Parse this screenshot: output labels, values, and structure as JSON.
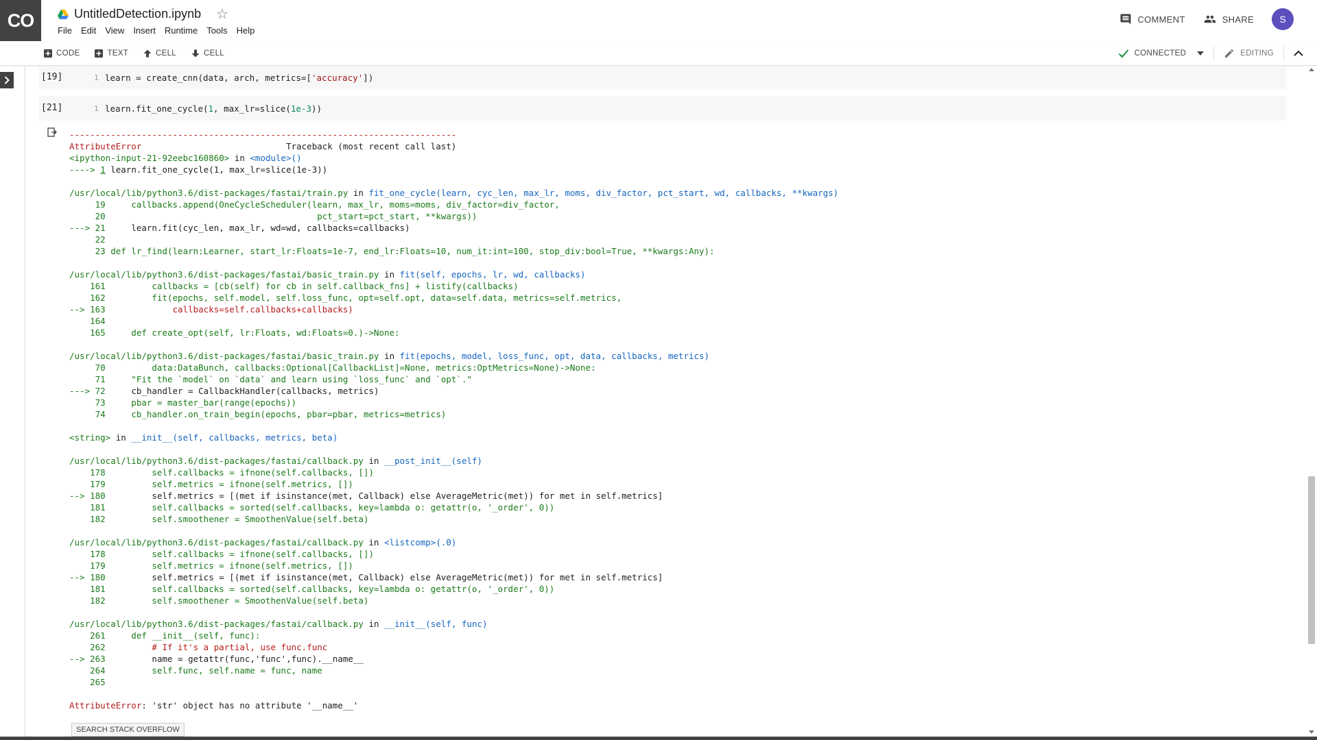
{
  "app": {
    "logo": "CO",
    "title": "UntitledDetection.ipynb",
    "menu": [
      "File",
      "Edit",
      "View",
      "Insert",
      "Runtime",
      "Tools",
      "Help"
    ],
    "comment_label": "COMMENT",
    "share_label": "SHARE",
    "avatar_letter": "S",
    "avatar_color": "#5b4fbd"
  },
  "toolbar": {
    "code_label": "CODE",
    "text_label": "TEXT",
    "cell_up_label": "CELL",
    "cell_down_label": "CELL",
    "connected_label": "CONNECTED",
    "editing_label": "EDITING"
  },
  "cells": [
    {
      "prompt": "[19]",
      "line_no": "1",
      "code_prefix": "learn = create_cnn(data, arch, metrics=[",
      "code_str": "'accuracy'",
      "code_suffix": "])"
    },
    {
      "prompt": "[21]",
      "line_no": "1",
      "code_prefix": "learn.fit_one_cycle(",
      "code_num1": "1",
      "code_mid": ", max_lr=slice(",
      "code_num2": "1e-3",
      "code_suffix": "))"
    }
  ],
  "output": {
    "dashes": "---------------------------------------------------------------------------",
    "err_type": "AttributeError",
    "traceback_label": "                            Traceback (most recent call last)",
    "ipy_input": "<ipython-input-21-92eebc160860>",
    "in_word": " in ",
    "module": "<module>()",
    "arrow1_prefix": "----> ",
    "arrow1_no": "1",
    "arrow1_code": " learn.fit_one_cycle(1, max_lr=slice(1e-3))",
    "f1_path": "/usr/local/lib/python3.6/dist-packages/fastai/train.py",
    "f1_func": "fit_one_cycle(learn, cyc_len, max_lr, moms, div_factor, pct_start, wd, callbacks, **kwargs)",
    "f1_l1": "     19     callbacks.append(OneCycleScheduler(learn, max_lr, moms=moms, div_factor=div_factor,",
    "f1_l2": "     20                                         pct_start=pct_start, **kwargs))",
    "f1_l3a": "---> 21",
    "f1_l3b": "     learn.fit(cyc_len, max_lr, wd=wd, callbacks=callbacks)",
    "f1_l4": "     22 ",
    "f1_l5": "     23 def lr_find(learn:Learner, start_lr:Floats=1e-7, end_lr:Floats=10, num_it:int=100, stop_div:bool=True, **kwargs:Any):",
    "f2_path": "/usr/local/lib/python3.6/dist-packages/fastai/basic_train.py",
    "f2_func": "fit(self, epochs, lr, wd, callbacks)",
    "f2_l1": "    161         callbacks = [cb(self) for cb in self.callback_fns] + listify(callbacks)",
    "f2_l2": "    162         fit(epochs, self.model, self.loss_func, opt=self.opt, data=self.data, metrics=self.metrics,",
    "f2_l3a": "--> 163",
    "f2_l3b": "             callbacks=self.callbacks+callbacks)",
    "f2_l4": "    164 ",
    "f2_l5": "    165     def create_opt(self, lr:Floats, wd:Floats=0.)->None:",
    "f3_path": "/usr/local/lib/python3.6/dist-packages/fastai/basic_train.py",
    "f3_func": "fit(epochs, model, loss_func, opt, data, callbacks, metrics)",
    "f3_l1": "     70         data:DataBunch, callbacks:Optional[CallbackList]=None, metrics:OptMetrics=None)->None:",
    "f3_l2": "     71     \"Fit the `model` on `data` and learn using `loss_func` and `opt`.\"",
    "f3_l3a": "---> 72",
    "f3_l3b": "     cb_handler = CallbackHandler(callbacks, metrics)",
    "f3_l4": "     73     pbar = master_bar(range(epochs))",
    "f3_l5": "     74     cb_handler.on_train_begin(epochs, pbar=pbar, metrics=metrics)",
    "f4_path": "<string>",
    "f4_func": "__init__(self, callbacks, metrics, beta)",
    "f5_path": "/usr/local/lib/python3.6/dist-packages/fastai/callback.py",
    "f5_func": "__post_init__(self)",
    "f5_l1": "    178         self.callbacks = ifnone(self.callbacks, [])",
    "f5_l2": "    179         self.metrics = ifnone(self.metrics, [])",
    "f5_l3a": "--> 180",
    "f5_l3b": "         self.metrics = [(met if isinstance(met, Callback) else AverageMetric(met)) for met in self.metrics]",
    "f5_l4": "    181         self.callbacks = sorted(self.callbacks, key=lambda o: getattr(o, '_order', 0))",
    "f5_l5": "    182         self.smoothener = SmoothenValue(self.beta)",
    "f6_path": "/usr/local/lib/python3.6/dist-packages/fastai/callback.py",
    "f6_func": "<listcomp>(.0)",
    "f6_l1": "    178         self.callbacks = ifnone(self.callbacks, [])",
    "f6_l2": "    179         self.metrics = ifnone(self.metrics, [])",
    "f6_l3a": "--> 180",
    "f6_l3b": "         self.metrics = [(met if isinstance(met, Callback) else AverageMetric(met)) for met in self.metrics]",
    "f6_l4": "    181         self.callbacks = sorted(self.callbacks, key=lambda o: getattr(o, '_order', 0))",
    "f6_l5": "    182         self.smoothener = SmoothenValue(self.beta)",
    "f7_path": "/usr/local/lib/python3.6/dist-packages/fastai/callback.py",
    "f7_func": "__init__(self, func)",
    "f7_l1": "    261     def __init__(self, func):",
    "f7_l2a": "    262         ",
    "f7_l2b": "# If it's a partial, use func.func",
    "f7_l3a": "--> 263",
    "f7_l3b": "         name = getattr(func,'func',func).__name__",
    "f7_l4": "    264         self.func, self.name = func, name",
    "f7_l5": "    265 ",
    "final_err_type": "AttributeError",
    "final_err_msg": ": 'str' object has no attribute '__name__'"
  },
  "search_so_label": "SEARCH STACK OVERFLOW"
}
